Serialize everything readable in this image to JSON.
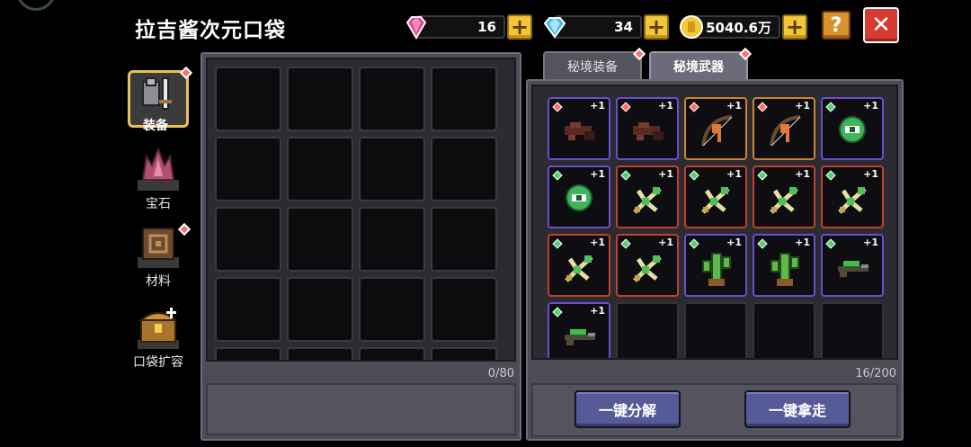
{
  "title": "拉吉酱次元口袋",
  "currencies": {
    "gem_pink": {
      "value": "16",
      "icon": "pink-gem-icon",
      "color": "#e8438f"
    },
    "gem_blue": {
      "value": "34",
      "icon": "blue-diamond-icon",
      "color": "#3fb8f0"
    },
    "gold": {
      "value": "5040.6万",
      "icon": "gold-coin-icon",
      "color": "#f2c935"
    }
  },
  "buttons": {
    "help": "?",
    "close": "✕",
    "plus": "+"
  },
  "side_tabs": [
    {
      "label": "装备",
      "icon": "armor-icon",
      "active": true,
      "badge": true
    },
    {
      "label": "宝石",
      "icon": "crystal-icon",
      "active": false,
      "badge": false
    },
    {
      "label": "材料",
      "icon": "materials-box-icon",
      "active": false,
      "badge": true
    },
    {
      "label": "口袋扩容",
      "icon": "treasure-chest-icon",
      "active": false,
      "badge": false
    }
  ],
  "left_panel": {
    "count": "0/80"
  },
  "right_tabs": [
    {
      "label": "秘境装备",
      "active": false,
      "badge": true
    },
    {
      "label": "秘境武器",
      "active": true,
      "badge": true
    }
  ],
  "right_panel": {
    "count": "16/200",
    "items": [
      {
        "icon": "crossbow-dark-icon",
        "badge": "red",
        "level": "+1",
        "rarity": "purple"
      },
      {
        "icon": "crossbow-dark-icon",
        "badge": "red",
        "level": "+1",
        "rarity": "purple"
      },
      {
        "icon": "bow-icon",
        "badge": "red",
        "level": "+1",
        "rarity": "orange"
      },
      {
        "icon": "bow-icon",
        "badge": "red",
        "level": "+1",
        "rarity": "orange"
      },
      {
        "icon": "slime-orb-icon",
        "badge": "green",
        "level": "+1",
        "rarity": "purple"
      },
      {
        "icon": "slime-orb-icon",
        "badge": "green",
        "level": "+1",
        "rarity": "purple"
      },
      {
        "icon": "bone-bow-icon",
        "badge": "green",
        "level": "+1",
        "rarity": "red"
      },
      {
        "icon": "bone-bow-icon",
        "badge": "green",
        "level": "+1",
        "rarity": "red"
      },
      {
        "icon": "bone-bow-icon",
        "badge": "green",
        "level": "+1",
        "rarity": "red"
      },
      {
        "icon": "bone-bow-icon",
        "badge": "green",
        "level": "+1",
        "rarity": "red"
      },
      {
        "icon": "bone-bow-icon",
        "badge": "green",
        "level": "+1",
        "rarity": "red"
      },
      {
        "icon": "bone-bow-icon",
        "badge": "green",
        "level": "+1",
        "rarity": "red"
      },
      {
        "icon": "cactus-icon",
        "badge": "green",
        "level": "+1",
        "rarity": "purple"
      },
      {
        "icon": "cactus-icon",
        "badge": "green",
        "level": "+1",
        "rarity": "purple"
      },
      {
        "icon": "green-rifle-icon",
        "badge": "green",
        "level": "+1",
        "rarity": "purple"
      },
      {
        "icon": "green-rifle-icon",
        "badge": "green",
        "level": "+1",
        "rarity": "purple"
      }
    ]
  },
  "actions": {
    "dismantle": "一键分解",
    "take_all": "一键拿走"
  }
}
